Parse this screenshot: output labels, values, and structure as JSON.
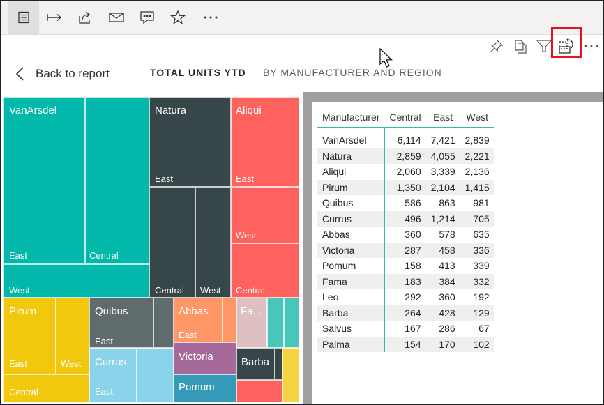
{
  "header": {
    "back_label": "Back to report",
    "title_primary": "TOTAL UNITS YTD",
    "title_secondary": "BY MANUFACTURER AND REGION"
  },
  "icons": {
    "toolbar": [
      "list-view-icon",
      "go-to-arrow-icon",
      "share-icon",
      "mail-icon",
      "comment-icon",
      "favorite-star-icon",
      "more-options-icon"
    ],
    "visual": [
      "pin-icon",
      "copy-icon",
      "filter-icon",
      "switch-visual-icon",
      "more-options-icon"
    ]
  },
  "colors": {
    "highlight": "#e81123",
    "vanarsdel": "#01b8aa",
    "natura": "#374649",
    "aliqui": "#fd625e",
    "pirum": "#f2c80f",
    "quibus": "#5f6b6d",
    "abbas": "#fe9666",
    "victoria": "#a66999",
    "currus": "#8ad4eb",
    "pomum": "#3599b8",
    "fama": "#dfbfbf",
    "barba": "#4a8ddc",
    "salvus": "#4ac5bb",
    "palma": "#f5d33f",
    "table_accent": "#3cb6a9"
  },
  "treemap": {
    "labels": {
      "vanarsdel": "VanArsdel",
      "natura": "Natura",
      "aliqui": "Aliqui",
      "pirum": "Pirum",
      "quibus": "Quibus",
      "abbas": "Abbas",
      "currus": "Currus",
      "victoria": "Victoria",
      "barba": "Barba",
      "pomum": "Pomum",
      "fama": "Fa...",
      "east": "East",
      "central": "Central",
      "west": "West"
    }
  },
  "table": {
    "columns": [
      "Manufacturer",
      "Central",
      "East",
      "West"
    ],
    "rows": [
      [
        "VanArsdel",
        "6,114",
        "7,421",
        "2,839"
      ],
      [
        "Natura",
        "2,859",
        "4,055",
        "2,221"
      ],
      [
        "Aliqui",
        "2,060",
        "3,339",
        "2,136"
      ],
      [
        "Pirum",
        "1,350",
        "2,104",
        "1,415"
      ],
      [
        "Quibus",
        "586",
        "863",
        "981"
      ],
      [
        "Currus",
        "496",
        "1,214",
        "705"
      ],
      [
        "Abbas",
        "360",
        "578",
        "635"
      ],
      [
        "Victoria",
        "287",
        "458",
        "336"
      ],
      [
        "Pomum",
        "158",
        "413",
        "339"
      ],
      [
        "Fama",
        "183",
        "384",
        "332"
      ],
      [
        "Leo",
        "292",
        "360",
        "192"
      ],
      [
        "Barba",
        "264",
        "428",
        "129"
      ],
      [
        "Salvus",
        "167",
        "286",
        "67"
      ],
      [
        "Palma",
        "154",
        "170",
        "102"
      ]
    ]
  }
}
